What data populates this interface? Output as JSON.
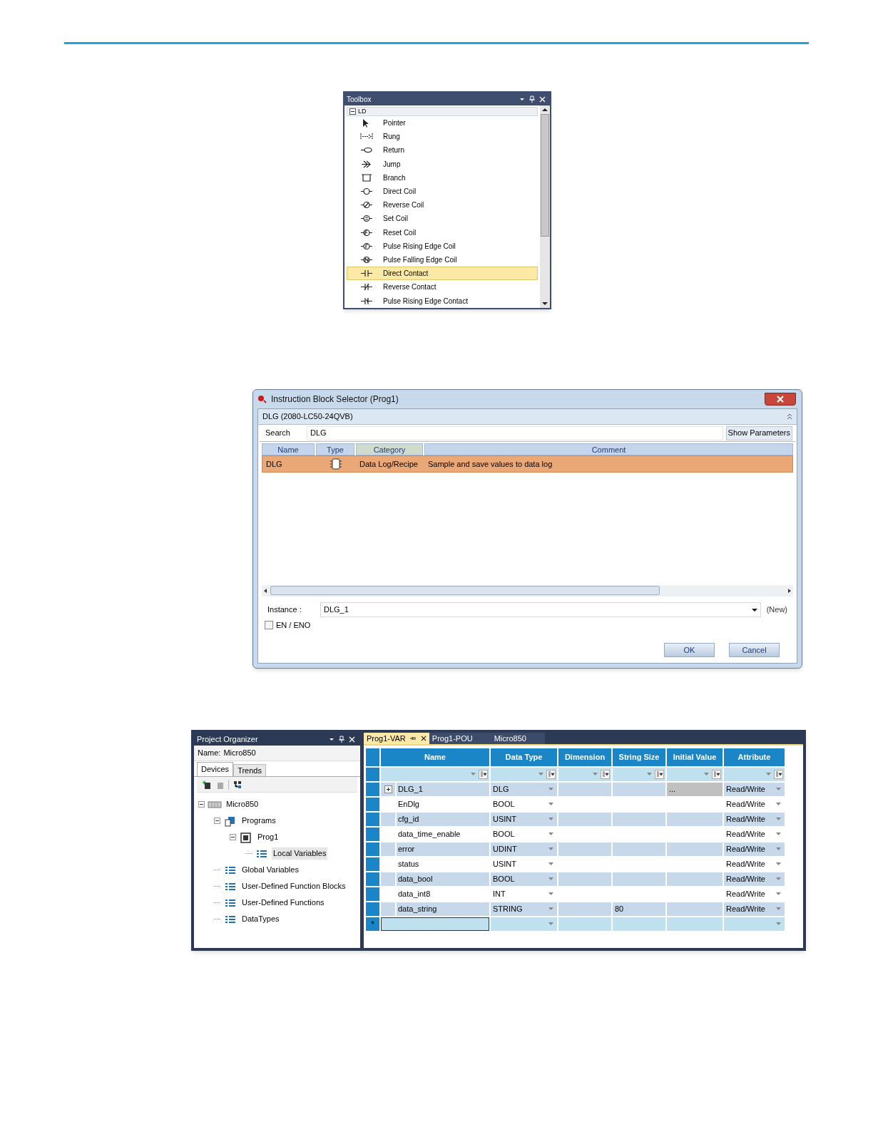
{
  "toolbox": {
    "title": "Toolbox",
    "group": {
      "label": "LD",
      "expanded": true
    },
    "items": [
      {
        "label": "Pointer",
        "selected": false
      },
      {
        "label": "Rung",
        "selected": false
      },
      {
        "label": "Return",
        "selected": false
      },
      {
        "label": "Jump",
        "selected": false
      },
      {
        "label": "Branch",
        "selected": false
      },
      {
        "label": "Direct Coil",
        "selected": false
      },
      {
        "label": "Reverse Coil",
        "selected": false
      },
      {
        "label": "Set Coil",
        "selected": false
      },
      {
        "label": "Reset Coil",
        "selected": false
      },
      {
        "label": "Pulse Rising Edge Coil",
        "selected": false
      },
      {
        "label": "Pulse Falling Edge Coil",
        "selected": false
      },
      {
        "label": "Direct Contact",
        "selected": true
      },
      {
        "label": "Reverse Contact",
        "selected": false
      },
      {
        "label": "Pulse Rising Edge Contact",
        "selected": false
      }
    ]
  },
  "dialog": {
    "title": "Instruction Block Selector (Prog1)",
    "header": "DLG (2080-LC50-24QVB)",
    "search_label": "Search",
    "search_value": "DLG",
    "show_parameters": "Show Parameters",
    "columns": [
      "Name",
      "Type",
      "Category",
      "Comment"
    ],
    "rows": [
      {
        "name": "DLG",
        "category": "Data Log/Recipe",
        "comment": "Sample and save values to data log",
        "selected": true
      }
    ],
    "instance_label": "Instance :",
    "instance_value": "DLG_1",
    "instance_note": "(New)",
    "en_eno": {
      "label": "EN / ENO",
      "checked": false
    },
    "buttons": [
      "OK",
      "Cancel"
    ]
  },
  "project_organizer": {
    "title": "Project Organizer",
    "name_label": "Name:",
    "name_value": "Micro850",
    "tabs": [
      {
        "label": "Devices",
        "selected": true
      },
      {
        "label": "Trends",
        "selected": false
      }
    ],
    "tree": [
      {
        "label": "Micro850",
        "expanded": true,
        "selected": false,
        "children": [
          {
            "label": "Programs",
            "expanded": true,
            "selected": false,
            "children": [
              {
                "label": "Prog1",
                "expanded": true,
                "selected": false,
                "children": [
                  {
                    "label": "Local Variables",
                    "selected": true
                  }
                ]
              }
            ]
          },
          {
            "label": "Global Variables",
            "selected": false
          },
          {
            "label": "User-Defined Function Blocks",
            "selected": false
          },
          {
            "label": "User-Defined Functions",
            "selected": false
          },
          {
            "label": "DataTypes",
            "selected": false
          }
        ]
      }
    ]
  },
  "variables": {
    "tabs": [
      {
        "label": "Prog1-VAR",
        "selected": true
      },
      {
        "label": "Prog1-POU",
        "selected": false
      },
      {
        "label": "Micro850",
        "selected": false
      }
    ],
    "columns": [
      "Name",
      "Data Type",
      "Dimension",
      "String Size",
      "Initial Value",
      "Attribute"
    ],
    "rows": [
      {
        "name": "DLG_1",
        "data_type": "DLG",
        "dimension": "",
        "string_size": "",
        "initial_value": "...",
        "attribute": "Read/Write",
        "expandable": true
      },
      {
        "name": "EnDlg",
        "data_type": "BOOL",
        "dimension": "",
        "string_size": "",
        "initial_value": "",
        "attribute": "Read/Write",
        "expandable": false
      },
      {
        "name": "cfg_id",
        "data_type": "USINT",
        "dimension": "",
        "string_size": "",
        "initial_value": "",
        "attribute": "Read/Write",
        "expandable": false
      },
      {
        "name": "data_time_enable",
        "data_type": "BOOL",
        "dimension": "",
        "string_size": "",
        "initial_value": "",
        "attribute": "Read/Write",
        "expandable": false
      },
      {
        "name": "error",
        "data_type": "UDINT",
        "dimension": "",
        "string_size": "",
        "initial_value": "",
        "attribute": "Read/Write",
        "expandable": false
      },
      {
        "name": "status",
        "data_type": "USINT",
        "dimension": "",
        "string_size": "",
        "initial_value": "",
        "attribute": "Read/Write",
        "expandable": false
      },
      {
        "name": "data_bool",
        "data_type": "BOOL",
        "dimension": "",
        "string_size": "",
        "initial_value": "",
        "attribute": "Read/Write",
        "expandable": false
      },
      {
        "name": "data_int8",
        "data_type": "INT",
        "dimension": "",
        "string_size": "",
        "initial_value": "",
        "attribute": "Read/Write",
        "expandable": false
      },
      {
        "name": "data_string",
        "data_type": "STRING",
        "dimension": "",
        "string_size": "80",
        "initial_value": "",
        "attribute": "Read/Write",
        "expandable": false
      }
    ],
    "new_row_marker": "*"
  }
}
